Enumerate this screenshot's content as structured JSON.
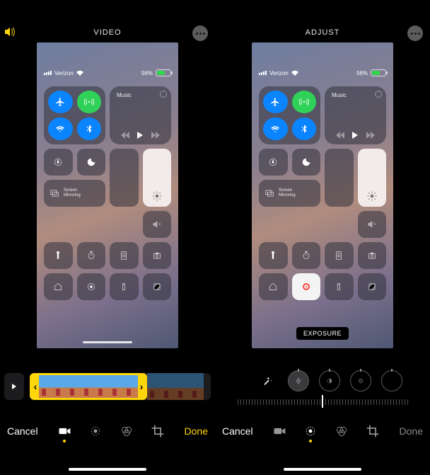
{
  "left": {
    "tab": "VIDEO",
    "bottom": {
      "cancel": "Cancel",
      "done": "Done"
    }
  },
  "right": {
    "tab": "ADJUST",
    "exposure_label": "EXPOSURE",
    "bottom": {
      "cancel": "Cancel",
      "done": "Done"
    }
  },
  "phone_status": {
    "carrier": "Verizon",
    "battery_pct": "56%"
  },
  "control_center": {
    "music_label": "Music",
    "screen_mirroring": "Screen\nMirroring"
  },
  "colors": {
    "accent": "#ffd60a",
    "ios_blue": "#0a84ff",
    "ios_green": "#30d158"
  }
}
